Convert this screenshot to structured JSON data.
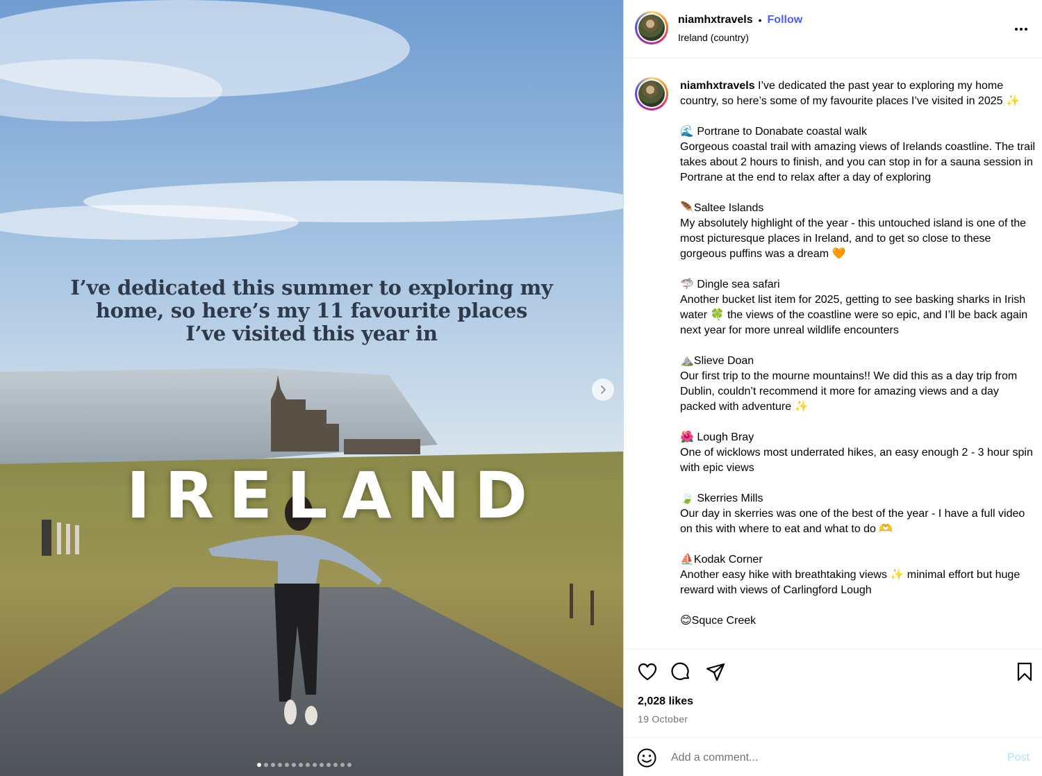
{
  "media": {
    "overlay_lines": [
      "I’ve dedicated this summer to exploring my",
      "home, so here’s my 11 favourite places",
      "I’ve visited this year in"
    ],
    "title": "IRELAND",
    "carousel": {
      "total_slides": 14,
      "active_index": 0
    },
    "next_icon": "chevron-right-icon"
  },
  "header": {
    "username": "niamhxtravels",
    "separator": "•",
    "follow_label": "Follow",
    "location": "Ireland (country)",
    "more_icon": "more-options-icon"
  },
  "caption": {
    "username": "niamhxtravels",
    "intro": " I’ve dedicated the past year to exploring my home country, so here’s some of my favourite places I’ve visited in 2025 ✨",
    "entries": [
      {
        "title": "🌊 Portrane to Donabate coastal walk",
        "body": "Gorgeous coastal trail with amazing views of Irelands coastline. The trail takes about 2 hours to finish, and you can stop in for a sauna session in Portrane at the end to relax after a day of exploring"
      },
      {
        "title": "🪶Saltee Islands",
        "body": "My absolutely highlight of the year - this untouched island is one of the most picturesque places in Ireland, and to get so close to these gorgeous puffins was a dream 🧡"
      },
      {
        "title": "🦈 Dingle sea safari",
        "body": "Another bucket list item for 2025, getting to see basking sharks in Irish water 🍀 the views of the coastline were so epic, and I’ll be back again next year for more unreal wildlife encounters"
      },
      {
        "title": "⛰️Slieve Doan",
        "body": "Our first trip to the mourne mountains!! We did this as a day trip from Dublin, couldn’t recommend it more for amazing views and a day packed with adventure ✨"
      },
      {
        "title": "🌺 Lough Bray",
        "body": "One of wicklows most underrated hikes, an easy enough 2 - 3 hour spin with epic views"
      },
      {
        "title": "🍃 Skerries Mills",
        "body": "Our day in skerries was one of the best of the year - I have a full video on this with where to eat and what to do 🫶"
      },
      {
        "title": "⛵Kodak Corner",
        "body": "Another easy hike with breathtaking views ✨ minimal effort but huge reward with views of Carlingford Lough"
      },
      {
        "title": "😊Squce Creek",
        "body": ""
      }
    ]
  },
  "actions": {
    "icons": [
      "heart-icon",
      "comment-icon",
      "share-icon",
      "bookmark-icon"
    ],
    "likes": "2,028 likes",
    "date": "19 October"
  },
  "comment": {
    "placeholder": "Add a comment...",
    "post_label": "Post",
    "emoji_icon": "emoji-icon"
  },
  "colors": {
    "follow_blue": "#4a5df9",
    "post_disabled": "#b2dffc",
    "muted_text": "#737373",
    "border": "#dbdbdb"
  }
}
